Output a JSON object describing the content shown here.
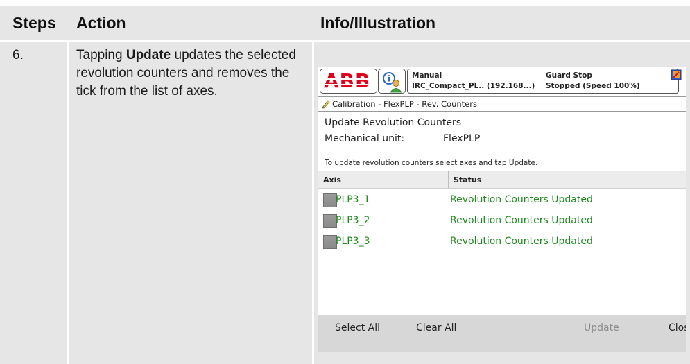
{
  "table": {
    "headers": [
      "Steps",
      "Action",
      "Info/Illustration"
    ],
    "rows": [
      {
        "step": "6.",
        "action_before": "Tapping ",
        "action_bold": "Update",
        "action_after": " updates the selected revolution counters and removes the tick from the list of axes."
      }
    ]
  },
  "flexpendant": {
    "logo_text": "ABB",
    "status": {
      "mode": "Manual",
      "controller": "IRC_Compact_PL.. (192.168...)",
      "guard": "Guard Stop",
      "state": "Stopped (Speed 100%)"
    },
    "breadcrumb": "Calibration - FlexPLP - Rev. Counters",
    "page_title": "Update Revolution Counters",
    "mechanical_unit_label": "Mechanical unit:",
    "mechanical_unit_value": "FlexPLP",
    "instruction": "To update revolution counters select axes and tap Update.",
    "columns": [
      "Axis",
      "Status"
    ],
    "axes": [
      {
        "name": "PLP3_1",
        "status": "Revolution Counters Updated",
        "checked": false
      },
      {
        "name": "PLP3_2",
        "status": "Revolution Counters Updated",
        "checked": false
      },
      {
        "name": "PLP3_3",
        "status": "Revolution Counters Updated",
        "checked": false
      }
    ],
    "buttons": {
      "select_all": "Select All",
      "clear_all": "Clear All",
      "update": "Update",
      "close": "Close"
    },
    "colors": {
      "logo_red": "#e1001a",
      "status_green": "#1e8a1e",
      "button_bar": "#d7d7d7"
    }
  }
}
